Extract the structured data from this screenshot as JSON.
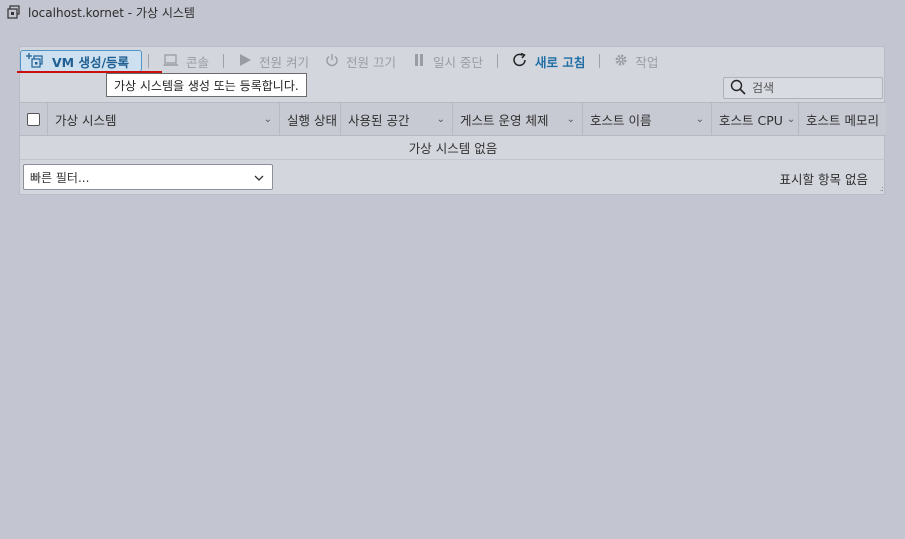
{
  "window": {
    "title": "localhost.kornet - 가상 시스템"
  },
  "toolbar": {
    "create_label": "VM 생성/등록",
    "console_label": "콘솔",
    "power_on_label": "전원 켜기",
    "power_off_label": "전원 끄기",
    "suspend_label": "일시 중단",
    "refresh_label": "새로 고침",
    "actions_label": "작업"
  },
  "tooltip": {
    "text": "가상 시스템을 생성 또는 등록합니다."
  },
  "search": {
    "placeholder": "검색",
    "value": ""
  },
  "grid": {
    "columns": [
      "가상 시스템",
      "실행 상태",
      "사용된 공간",
      "게스트 운영 체제",
      "호스트 이름",
      "호스트 CPU",
      "호스트 메모리"
    ],
    "empty_text": "가상 시스템 없음"
  },
  "footer": {
    "quick_filter_label": "빠른 필터...",
    "no_items_text": "표시할 항목 없음"
  },
  "colors": {
    "accent": "#1f6fa6",
    "background": "#c3c5d0",
    "panel": "#d4d6de",
    "underline": "#cc1010"
  }
}
